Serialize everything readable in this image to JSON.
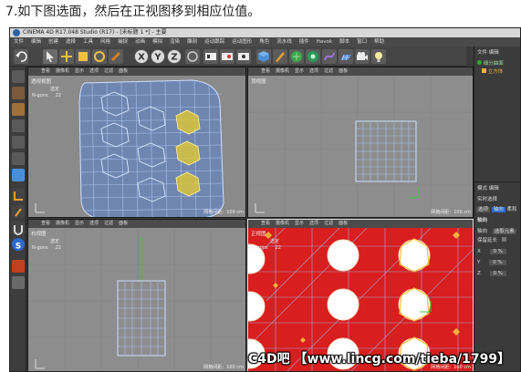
{
  "caption": "7.如下图选面，然后在正视图移到相应位值。",
  "window": {
    "title": "CINEMA 4D R17.048 Studio (R17) - [未标题 1 *] - 主要"
  },
  "menubar": [
    "文件",
    "编辑",
    "创建",
    "选择",
    "工具",
    "网格",
    "捕捉",
    "动画",
    "模拟",
    "渲染",
    "雕刻",
    "运动跟踪",
    "运动图形",
    "角色",
    "流水线",
    "插件",
    "Havok",
    "脚本",
    "窗口",
    "帮助"
  ],
  "toolbar": {
    "axis_x": "X",
    "axis_y": "Y",
    "axis_z": "Z"
  },
  "viewports": {
    "perspective": {
      "name": "透视视图",
      "stat_label": "选定",
      "stat_key": "N-gons",
      "stat_val": "22",
      "footer": "网格间距：100 cm"
    },
    "top": {
      "name": "顶视图",
      "footer": "网格间距：100 cm"
    },
    "right": {
      "name": "右视图",
      "stat_label": "选定",
      "stat_key": "N-gons",
      "stat_val": "22",
      "footer": "网格间距：100 cm"
    },
    "front": {
      "name": "正视图",
      "stat_label": "选定",
      "stat_key": "N-gons",
      "stat_val": "22",
      "footer": "网格间距：100 cm"
    }
  },
  "viewport_menu": [
    "查看",
    "摄像机",
    "显示",
    "选项",
    "过滤",
    "面板"
  ],
  "right_panel": {
    "tabs": [
      "文件",
      "编辑",
      "查看"
    ],
    "object1": "细分曲面",
    "object2": "立方体",
    "attr_tabs": [
      "模式",
      "编辑",
      "用户"
    ],
    "attr_title": "实时选择",
    "attr_subtabs": [
      "选项",
      "轴向",
      "柔和"
    ],
    "section": "轴向",
    "axis_label": "轴向",
    "axis_value": "选取元素",
    "keep_label": "保留延长",
    "x_label": "X",
    "y_label": "Y",
    "z_label": "Z",
    "x_val": "0 %",
    "y_val": "0 %",
    "z_val": "0 %"
  },
  "watermark": {
    "brand": "C4D吧",
    "url": "【www.lincg.com/tieba/1799】"
  }
}
